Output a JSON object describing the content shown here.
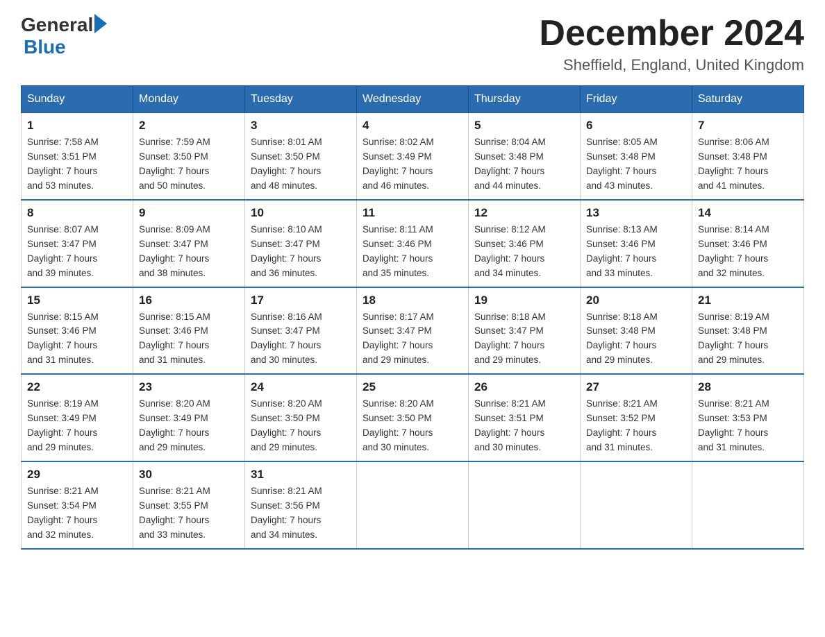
{
  "header": {
    "logo_general": "General",
    "logo_blue": "Blue",
    "title": "December 2024",
    "subtitle": "Sheffield, England, United Kingdom"
  },
  "columns": [
    "Sunday",
    "Monday",
    "Tuesday",
    "Wednesday",
    "Thursday",
    "Friday",
    "Saturday"
  ],
  "weeks": [
    [
      {
        "day": "1",
        "sunrise": "7:58 AM",
        "sunset": "3:51 PM",
        "daylight": "7 hours and 53 minutes."
      },
      {
        "day": "2",
        "sunrise": "7:59 AM",
        "sunset": "3:50 PM",
        "daylight": "7 hours and 50 minutes."
      },
      {
        "day": "3",
        "sunrise": "8:01 AM",
        "sunset": "3:50 PM",
        "daylight": "7 hours and 48 minutes."
      },
      {
        "day": "4",
        "sunrise": "8:02 AM",
        "sunset": "3:49 PM",
        "daylight": "7 hours and 46 minutes."
      },
      {
        "day": "5",
        "sunrise": "8:04 AM",
        "sunset": "3:48 PM",
        "daylight": "7 hours and 44 minutes."
      },
      {
        "day": "6",
        "sunrise": "8:05 AM",
        "sunset": "3:48 PM",
        "daylight": "7 hours and 43 minutes."
      },
      {
        "day": "7",
        "sunrise": "8:06 AM",
        "sunset": "3:48 PM",
        "daylight": "7 hours and 41 minutes."
      }
    ],
    [
      {
        "day": "8",
        "sunrise": "8:07 AM",
        "sunset": "3:47 PM",
        "daylight": "7 hours and 39 minutes."
      },
      {
        "day": "9",
        "sunrise": "8:09 AM",
        "sunset": "3:47 PM",
        "daylight": "7 hours and 38 minutes."
      },
      {
        "day": "10",
        "sunrise": "8:10 AM",
        "sunset": "3:47 PM",
        "daylight": "7 hours and 36 minutes."
      },
      {
        "day": "11",
        "sunrise": "8:11 AM",
        "sunset": "3:46 PM",
        "daylight": "7 hours and 35 minutes."
      },
      {
        "day": "12",
        "sunrise": "8:12 AM",
        "sunset": "3:46 PM",
        "daylight": "7 hours and 34 minutes."
      },
      {
        "day": "13",
        "sunrise": "8:13 AM",
        "sunset": "3:46 PM",
        "daylight": "7 hours and 33 minutes."
      },
      {
        "day": "14",
        "sunrise": "8:14 AM",
        "sunset": "3:46 PM",
        "daylight": "7 hours and 32 minutes."
      }
    ],
    [
      {
        "day": "15",
        "sunrise": "8:15 AM",
        "sunset": "3:46 PM",
        "daylight": "7 hours and 31 minutes."
      },
      {
        "day": "16",
        "sunrise": "8:15 AM",
        "sunset": "3:46 PM",
        "daylight": "7 hours and 31 minutes."
      },
      {
        "day": "17",
        "sunrise": "8:16 AM",
        "sunset": "3:47 PM",
        "daylight": "7 hours and 30 minutes."
      },
      {
        "day": "18",
        "sunrise": "8:17 AM",
        "sunset": "3:47 PM",
        "daylight": "7 hours and 29 minutes."
      },
      {
        "day": "19",
        "sunrise": "8:18 AM",
        "sunset": "3:47 PM",
        "daylight": "7 hours and 29 minutes."
      },
      {
        "day": "20",
        "sunrise": "8:18 AM",
        "sunset": "3:48 PM",
        "daylight": "7 hours and 29 minutes."
      },
      {
        "day": "21",
        "sunrise": "8:19 AM",
        "sunset": "3:48 PM",
        "daylight": "7 hours and 29 minutes."
      }
    ],
    [
      {
        "day": "22",
        "sunrise": "8:19 AM",
        "sunset": "3:49 PM",
        "daylight": "7 hours and 29 minutes."
      },
      {
        "day": "23",
        "sunrise": "8:20 AM",
        "sunset": "3:49 PM",
        "daylight": "7 hours and 29 minutes."
      },
      {
        "day": "24",
        "sunrise": "8:20 AM",
        "sunset": "3:50 PM",
        "daylight": "7 hours and 29 minutes."
      },
      {
        "day": "25",
        "sunrise": "8:20 AM",
        "sunset": "3:50 PM",
        "daylight": "7 hours and 30 minutes."
      },
      {
        "day": "26",
        "sunrise": "8:21 AM",
        "sunset": "3:51 PM",
        "daylight": "7 hours and 30 minutes."
      },
      {
        "day": "27",
        "sunrise": "8:21 AM",
        "sunset": "3:52 PM",
        "daylight": "7 hours and 31 minutes."
      },
      {
        "day": "28",
        "sunrise": "8:21 AM",
        "sunset": "3:53 PM",
        "daylight": "7 hours and 31 minutes."
      }
    ],
    [
      {
        "day": "29",
        "sunrise": "8:21 AM",
        "sunset": "3:54 PM",
        "daylight": "7 hours and 32 minutes."
      },
      {
        "day": "30",
        "sunrise": "8:21 AM",
        "sunset": "3:55 PM",
        "daylight": "7 hours and 33 minutes."
      },
      {
        "day": "31",
        "sunrise": "8:21 AM",
        "sunset": "3:56 PM",
        "daylight": "7 hours and 34 minutes."
      },
      null,
      null,
      null,
      null
    ]
  ],
  "sunrise_label": "Sunrise:",
  "sunset_label": "Sunset:",
  "daylight_label": "Daylight:"
}
